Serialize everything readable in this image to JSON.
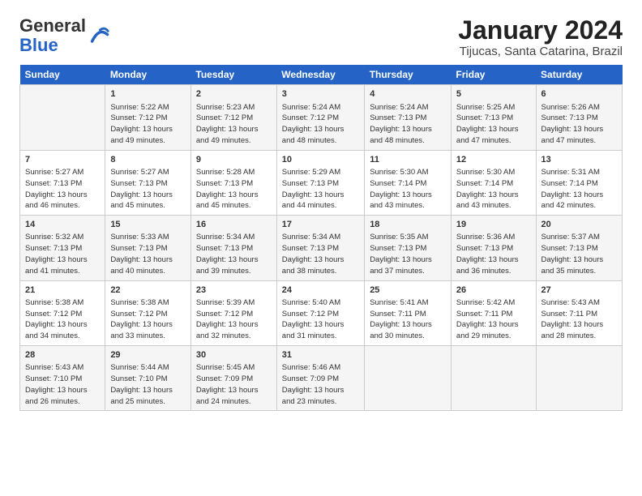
{
  "logo": {
    "general": "General",
    "blue": "Blue"
  },
  "header": {
    "month_year": "January 2024",
    "location": "Tijucas, Santa Catarina, Brazil"
  },
  "days_of_week": [
    "Sunday",
    "Monday",
    "Tuesday",
    "Wednesday",
    "Thursday",
    "Friday",
    "Saturday"
  ],
  "weeks": [
    [
      {
        "day": "",
        "info": ""
      },
      {
        "day": "1",
        "info": "Sunrise: 5:22 AM\nSunset: 7:12 PM\nDaylight: 13 hours\nand 49 minutes."
      },
      {
        "day": "2",
        "info": "Sunrise: 5:23 AM\nSunset: 7:12 PM\nDaylight: 13 hours\nand 49 minutes."
      },
      {
        "day": "3",
        "info": "Sunrise: 5:24 AM\nSunset: 7:12 PM\nDaylight: 13 hours\nand 48 minutes."
      },
      {
        "day": "4",
        "info": "Sunrise: 5:24 AM\nSunset: 7:13 PM\nDaylight: 13 hours\nand 48 minutes."
      },
      {
        "day": "5",
        "info": "Sunrise: 5:25 AM\nSunset: 7:13 PM\nDaylight: 13 hours\nand 47 minutes."
      },
      {
        "day": "6",
        "info": "Sunrise: 5:26 AM\nSunset: 7:13 PM\nDaylight: 13 hours\nand 47 minutes."
      }
    ],
    [
      {
        "day": "7",
        "info": "Sunrise: 5:27 AM\nSunset: 7:13 PM\nDaylight: 13 hours\nand 46 minutes."
      },
      {
        "day": "8",
        "info": "Sunrise: 5:27 AM\nSunset: 7:13 PM\nDaylight: 13 hours\nand 45 minutes."
      },
      {
        "day": "9",
        "info": "Sunrise: 5:28 AM\nSunset: 7:13 PM\nDaylight: 13 hours\nand 45 minutes."
      },
      {
        "day": "10",
        "info": "Sunrise: 5:29 AM\nSunset: 7:13 PM\nDaylight: 13 hours\nand 44 minutes."
      },
      {
        "day": "11",
        "info": "Sunrise: 5:30 AM\nSunset: 7:14 PM\nDaylight: 13 hours\nand 43 minutes."
      },
      {
        "day": "12",
        "info": "Sunrise: 5:30 AM\nSunset: 7:14 PM\nDaylight: 13 hours\nand 43 minutes."
      },
      {
        "day": "13",
        "info": "Sunrise: 5:31 AM\nSunset: 7:14 PM\nDaylight: 13 hours\nand 42 minutes."
      }
    ],
    [
      {
        "day": "14",
        "info": "Sunrise: 5:32 AM\nSunset: 7:13 PM\nDaylight: 13 hours\nand 41 minutes."
      },
      {
        "day": "15",
        "info": "Sunrise: 5:33 AM\nSunset: 7:13 PM\nDaylight: 13 hours\nand 40 minutes."
      },
      {
        "day": "16",
        "info": "Sunrise: 5:34 AM\nSunset: 7:13 PM\nDaylight: 13 hours\nand 39 minutes."
      },
      {
        "day": "17",
        "info": "Sunrise: 5:34 AM\nSunset: 7:13 PM\nDaylight: 13 hours\nand 38 minutes."
      },
      {
        "day": "18",
        "info": "Sunrise: 5:35 AM\nSunset: 7:13 PM\nDaylight: 13 hours\nand 37 minutes."
      },
      {
        "day": "19",
        "info": "Sunrise: 5:36 AM\nSunset: 7:13 PM\nDaylight: 13 hours\nand 36 minutes."
      },
      {
        "day": "20",
        "info": "Sunrise: 5:37 AM\nSunset: 7:13 PM\nDaylight: 13 hours\nand 35 minutes."
      }
    ],
    [
      {
        "day": "21",
        "info": "Sunrise: 5:38 AM\nSunset: 7:12 PM\nDaylight: 13 hours\nand 34 minutes."
      },
      {
        "day": "22",
        "info": "Sunrise: 5:38 AM\nSunset: 7:12 PM\nDaylight: 13 hours\nand 33 minutes."
      },
      {
        "day": "23",
        "info": "Sunrise: 5:39 AM\nSunset: 7:12 PM\nDaylight: 13 hours\nand 32 minutes."
      },
      {
        "day": "24",
        "info": "Sunrise: 5:40 AM\nSunset: 7:12 PM\nDaylight: 13 hours\nand 31 minutes."
      },
      {
        "day": "25",
        "info": "Sunrise: 5:41 AM\nSunset: 7:11 PM\nDaylight: 13 hours\nand 30 minutes."
      },
      {
        "day": "26",
        "info": "Sunrise: 5:42 AM\nSunset: 7:11 PM\nDaylight: 13 hours\nand 29 minutes."
      },
      {
        "day": "27",
        "info": "Sunrise: 5:43 AM\nSunset: 7:11 PM\nDaylight: 13 hours\nand 28 minutes."
      }
    ],
    [
      {
        "day": "28",
        "info": "Sunrise: 5:43 AM\nSunset: 7:10 PM\nDaylight: 13 hours\nand 26 minutes."
      },
      {
        "day": "29",
        "info": "Sunrise: 5:44 AM\nSunset: 7:10 PM\nDaylight: 13 hours\nand 25 minutes."
      },
      {
        "day": "30",
        "info": "Sunrise: 5:45 AM\nSunset: 7:09 PM\nDaylight: 13 hours\nand 24 minutes."
      },
      {
        "day": "31",
        "info": "Sunrise: 5:46 AM\nSunset: 7:09 PM\nDaylight: 13 hours\nand 23 minutes."
      },
      {
        "day": "",
        "info": ""
      },
      {
        "day": "",
        "info": ""
      },
      {
        "day": "",
        "info": ""
      }
    ]
  ]
}
